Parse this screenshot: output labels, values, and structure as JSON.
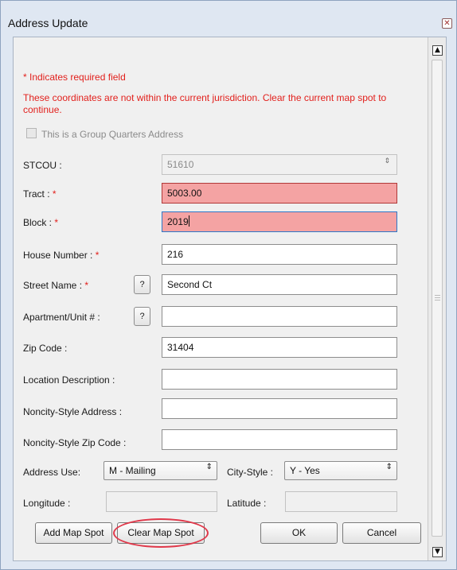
{
  "window": {
    "title": "Address Update",
    "close_glyph": "✕"
  },
  "notes": {
    "required": "* Indicates required field",
    "warning": "These coordinates are not within the current jurisdiction. Clear the current map spot to continue."
  },
  "group_quarters": {
    "label": "This is a Group Quarters Address",
    "checked": false
  },
  "fields": {
    "stcou": {
      "label": "STCOU :",
      "value": "51610"
    },
    "tract": {
      "label": "Tract :",
      "required_mark": "*",
      "value": "5003.00"
    },
    "block": {
      "label": "Block :",
      "required_mark": "*",
      "value": "2019"
    },
    "house_number": {
      "label": "House Number :",
      "required_mark": "*",
      "value": "216"
    },
    "street_name": {
      "label": "Street Name :",
      "required_mark": "*",
      "help": "?",
      "value": "Second Ct"
    },
    "apartment": {
      "label": "Apartment/Unit # :",
      "help": "?",
      "value": ""
    },
    "zip_code": {
      "label": "Zip Code :",
      "value": "31404"
    },
    "location_description": {
      "label": "Location Description :",
      "value": ""
    },
    "noncity_address": {
      "label": "Noncity-Style Address :",
      "value": ""
    },
    "noncity_zip": {
      "label": "Noncity-Style Zip Code :",
      "value": ""
    },
    "address_use": {
      "label": "Address Use:",
      "selected": "M - Mailing"
    },
    "city_style": {
      "label": "City-Style :",
      "selected": "Y - Yes"
    },
    "longitude": {
      "label": "Longitude :",
      "value": ""
    },
    "latitude": {
      "label": "Latitude :",
      "value": ""
    }
  },
  "buttons": {
    "add_map_spot": "Add Map Spot",
    "clear_map_spot": "Clear Map Spot",
    "ok": "OK",
    "cancel": "Cancel"
  },
  "glyphs": {
    "spin": "⇕",
    "select": "⇕",
    "scroll_up": "▲",
    "scroll_down": "▼"
  },
  "colors": {
    "required": "#e2201c",
    "error_fill": "#f4a3a3",
    "highlight_ring": "#e0384a"
  }
}
